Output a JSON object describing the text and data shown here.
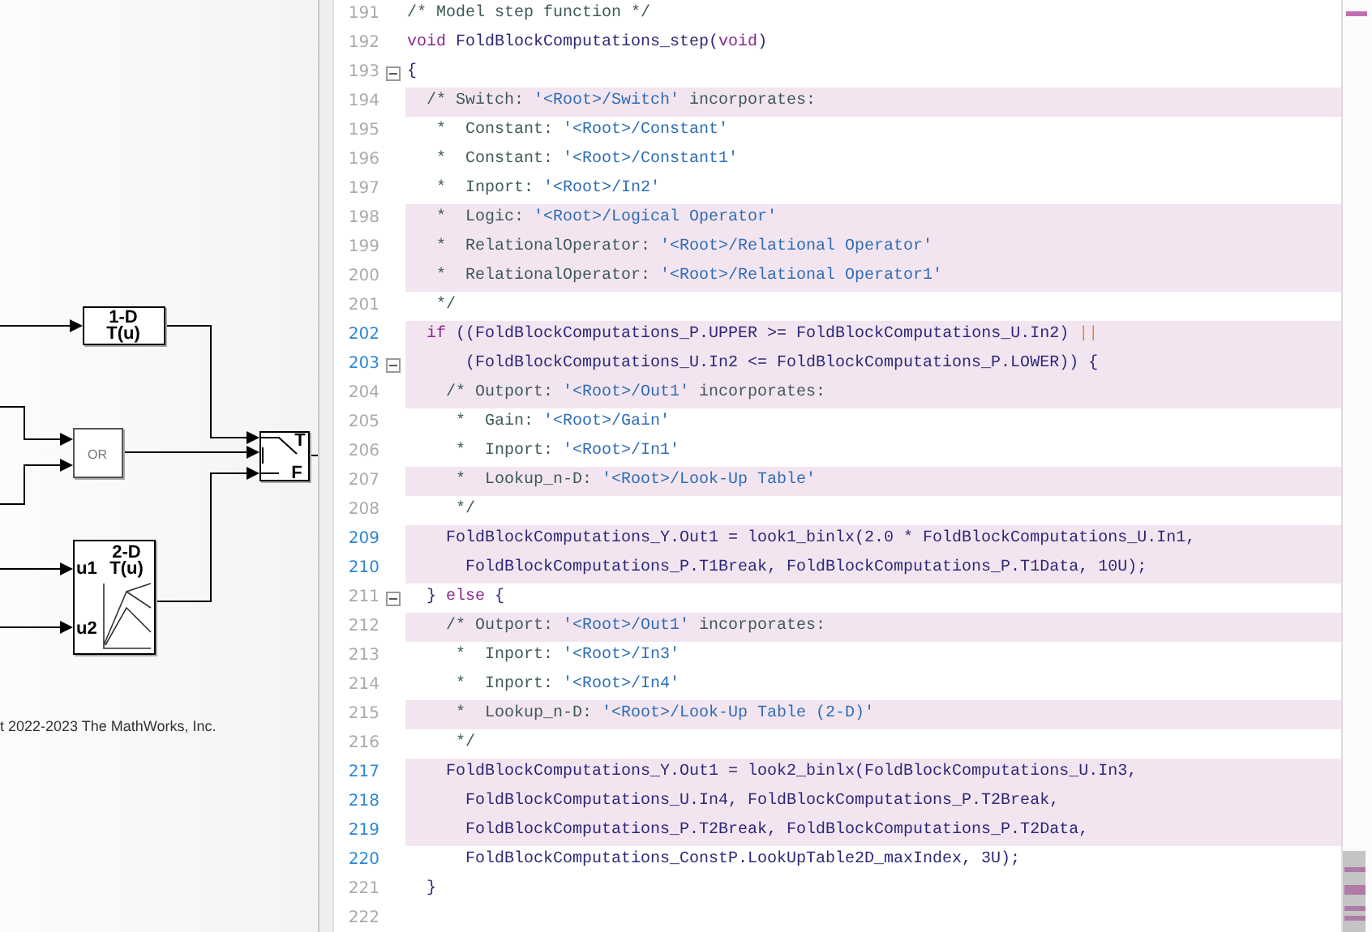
{
  "diagram": {
    "blocks": [
      {
        "kind": "lookup1d",
        "lines": [
          "1-D",
          "T(u)"
        ]
      },
      {
        "kind": "logic",
        "lines": [
          "OR"
        ]
      },
      {
        "kind": "switch",
        "lines": [
          "T",
          "F"
        ]
      },
      {
        "kind": "lookup2d",
        "lines": [
          "2-D",
          "T(u)"
        ],
        "ports": [
          "u1",
          "u2"
        ]
      }
    ],
    "copyright": "t 2022-2023 The MathWorks, Inc."
  },
  "code": {
    "lines": [
      {
        "number": "191",
        "highlighted": false,
        "linked": false,
        "foldable": false,
        "tokens": [
          {
            "kind": "comment",
            "text": "/* Model step function */"
          }
        ]
      },
      {
        "number": "192",
        "highlighted": false,
        "linked": false,
        "foldable": false,
        "tokens": [
          {
            "kind": "keyword",
            "text": "void"
          },
          {
            "kind": "code",
            "text": " FoldBlockComputations_step("
          },
          {
            "kind": "keyword",
            "text": "void"
          },
          {
            "kind": "code",
            "text": ")"
          }
        ]
      },
      {
        "number": "193",
        "highlighted": false,
        "linked": false,
        "foldable": true,
        "tokens": [
          {
            "kind": "code",
            "text": "{"
          }
        ]
      },
      {
        "number": "194",
        "highlighted": true,
        "linked": false,
        "foldable": false,
        "tokens": [
          {
            "kind": "comment",
            "text": "  /* Switch: "
          },
          {
            "kind": "string",
            "text": "'<Root>/Switch'"
          },
          {
            "kind": "comment",
            "text": " incorporates:"
          }
        ]
      },
      {
        "number": "195",
        "highlighted": false,
        "linked": false,
        "foldable": false,
        "tokens": [
          {
            "kind": "comment",
            "text": "   *  Constant: "
          },
          {
            "kind": "string",
            "text": "'<Root>/Constant'"
          }
        ]
      },
      {
        "number": "196",
        "highlighted": false,
        "linked": false,
        "foldable": false,
        "tokens": [
          {
            "kind": "comment",
            "text": "   *  Constant: "
          },
          {
            "kind": "string",
            "text": "'<Root>/Constant1'"
          }
        ]
      },
      {
        "number": "197",
        "highlighted": false,
        "linked": false,
        "foldable": false,
        "tokens": [
          {
            "kind": "comment",
            "text": "   *  Inport: "
          },
          {
            "kind": "string",
            "text": "'<Root>/In2'"
          }
        ]
      },
      {
        "number": "198",
        "highlighted": true,
        "linked": false,
        "foldable": false,
        "tokens": [
          {
            "kind": "comment",
            "text": "   *  Logic: "
          },
          {
            "kind": "string",
            "text": "'<Root>/Logical Operator'"
          }
        ]
      },
      {
        "number": "199",
        "highlighted": true,
        "linked": false,
        "foldable": false,
        "tokens": [
          {
            "kind": "comment",
            "text": "   *  RelationalOperator: "
          },
          {
            "kind": "string",
            "text": "'<Root>/Relational Operator'"
          }
        ]
      },
      {
        "number": "200",
        "highlighted": true,
        "linked": false,
        "foldable": false,
        "tokens": [
          {
            "kind": "comment",
            "text": "   *  RelationalOperator: "
          },
          {
            "kind": "string",
            "text": "'<Root>/Relational Operator1'"
          }
        ]
      },
      {
        "number": "201",
        "highlighted": false,
        "linked": false,
        "foldable": false,
        "tokens": [
          {
            "kind": "comment",
            "text": "   */"
          }
        ]
      },
      {
        "number": "202",
        "highlighted": true,
        "linked": true,
        "foldable": false,
        "tokens": [
          {
            "kind": "keyword",
            "text": "  if"
          },
          {
            "kind": "code",
            "text": " ((FoldBlockComputations_P.UPPER >= FoldBlockComputations_U.In2) "
          },
          {
            "kind": "operator",
            "text": "||"
          }
        ]
      },
      {
        "number": "203",
        "highlighted": true,
        "linked": true,
        "foldable": true,
        "tokens": [
          {
            "kind": "code",
            "text": "      (FoldBlockComputations_U.In2 <= FoldBlockComputations_P.LOWER)) {"
          }
        ]
      },
      {
        "number": "204",
        "highlighted": true,
        "linked": false,
        "foldable": false,
        "tokens": [
          {
            "kind": "comment",
            "text": "    /* Outport: "
          },
          {
            "kind": "string",
            "text": "'<Root>/Out1'"
          },
          {
            "kind": "comment",
            "text": " incorporates:"
          }
        ]
      },
      {
        "number": "205",
        "highlighted": false,
        "linked": false,
        "foldable": false,
        "tokens": [
          {
            "kind": "comment",
            "text": "     *  Gain: "
          },
          {
            "kind": "string",
            "text": "'<Root>/Gain'"
          }
        ]
      },
      {
        "number": "206",
        "highlighted": false,
        "linked": false,
        "foldable": false,
        "tokens": [
          {
            "kind": "comment",
            "text": "     *  Inport: "
          },
          {
            "kind": "string",
            "text": "'<Root>/In1'"
          }
        ]
      },
      {
        "number": "207",
        "highlighted": true,
        "linked": false,
        "foldable": false,
        "tokens": [
          {
            "kind": "comment",
            "text": "     *  Lookup_n-D: "
          },
          {
            "kind": "string",
            "text": "'<Root>/Look-Up Table'"
          }
        ]
      },
      {
        "number": "208",
        "highlighted": false,
        "linked": false,
        "foldable": false,
        "tokens": [
          {
            "kind": "comment",
            "text": "     */"
          }
        ]
      },
      {
        "number": "209",
        "highlighted": true,
        "linked": true,
        "foldable": false,
        "tokens": [
          {
            "kind": "code",
            "text": "    FoldBlockComputations_Y.Out1 = look1_binlx(2.0 * FoldBlockComputations_U.In1,"
          }
        ]
      },
      {
        "number": "210",
        "highlighted": true,
        "linked": true,
        "foldable": false,
        "tokens": [
          {
            "kind": "code",
            "text": "      FoldBlockComputations_P.T1Break, FoldBlockComputations_P.T1Data, 10U);"
          }
        ]
      },
      {
        "number": "211",
        "highlighted": false,
        "linked": false,
        "foldable": true,
        "tokens": [
          {
            "kind": "code",
            "text": "  } "
          },
          {
            "kind": "keyword",
            "text": "else"
          },
          {
            "kind": "code",
            "text": " {"
          }
        ]
      },
      {
        "number": "212",
        "highlighted": true,
        "linked": false,
        "foldable": false,
        "tokens": [
          {
            "kind": "comment",
            "text": "    /* Outport: "
          },
          {
            "kind": "string",
            "text": "'<Root>/Out1'"
          },
          {
            "kind": "comment",
            "text": " incorporates:"
          }
        ]
      },
      {
        "number": "213",
        "highlighted": false,
        "linked": false,
        "foldable": false,
        "tokens": [
          {
            "kind": "comment",
            "text": "     *  Inport: "
          },
          {
            "kind": "string",
            "text": "'<Root>/In3'"
          }
        ]
      },
      {
        "number": "214",
        "highlighted": false,
        "linked": false,
        "foldable": false,
        "tokens": [
          {
            "kind": "comment",
            "text": "     *  Inport: "
          },
          {
            "kind": "string",
            "text": "'<Root>/In4'"
          }
        ]
      },
      {
        "number": "215",
        "highlighted": true,
        "linked": false,
        "foldable": false,
        "tokens": [
          {
            "kind": "comment",
            "text": "     *  Lookup_n-D: "
          },
          {
            "kind": "string",
            "text": "'<Root>/Look-Up Table (2-D)'"
          }
        ]
      },
      {
        "number": "216",
        "highlighted": false,
        "linked": false,
        "foldable": false,
        "tokens": [
          {
            "kind": "comment",
            "text": "     */"
          }
        ]
      },
      {
        "number": "217",
        "highlighted": true,
        "linked": true,
        "foldable": false,
        "tokens": [
          {
            "kind": "code",
            "text": "    FoldBlockComputations_Y.Out1 = look2_binlx(FoldBlockComputations_U.In3,"
          }
        ]
      },
      {
        "number": "218",
        "highlighted": true,
        "linked": true,
        "foldable": false,
        "tokens": [
          {
            "kind": "code",
            "text": "      FoldBlockComputations_U.In4, FoldBlockComputations_P.T2Break,"
          }
        ]
      },
      {
        "number": "219",
        "highlighted": true,
        "linked": true,
        "foldable": false,
        "tokens": [
          {
            "kind": "code",
            "text": "      FoldBlockComputations_P.T2Break, FoldBlockComputations_P.T2Data,"
          }
        ]
      },
      {
        "number": "220",
        "highlighted": false,
        "linked": true,
        "foldable": false,
        "tokens": [
          {
            "kind": "code",
            "text": "      FoldBlockComputations_ConstP.LookUpTable2D_maxIndex, 3U);"
          }
        ]
      },
      {
        "number": "221",
        "highlighted": false,
        "linked": false,
        "foldable": false,
        "tokens": [
          {
            "kind": "code",
            "text": "  }"
          }
        ]
      },
      {
        "number": "222",
        "highlighted": false,
        "linked": false,
        "foldable": false
      }
    ]
  }
}
